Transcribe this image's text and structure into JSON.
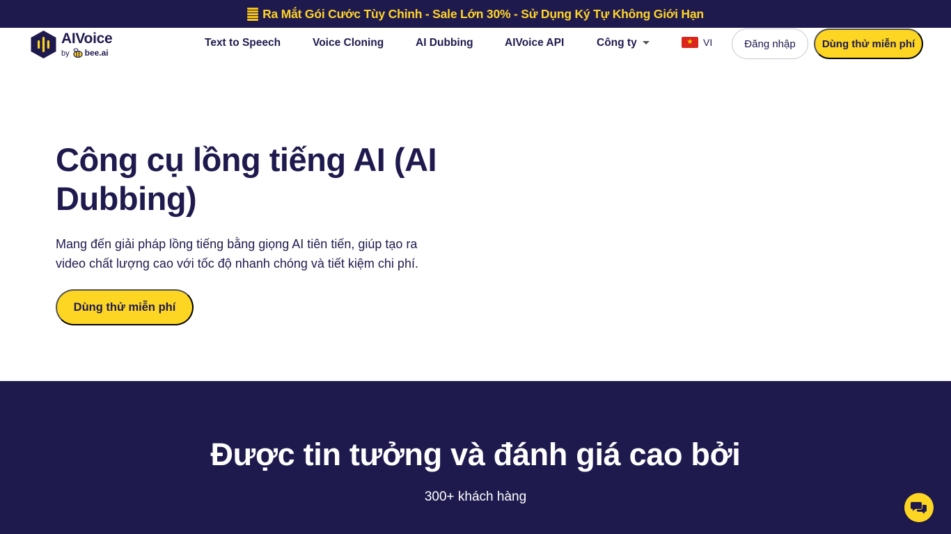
{
  "promo": {
    "icon": "coin-stack-icon",
    "text": "Ra Mắt Gói Cước Tùy Chỉnh - Sale Lớn 30% - Sử Dụng Ký Tự Không Giới Hạn"
  },
  "logo": {
    "title": "AIVoice",
    "by": "by",
    "brand": "bee.ai"
  },
  "nav": {
    "items": [
      {
        "label": "Text to Speech"
      },
      {
        "label": "Voice Cloning"
      },
      {
        "label": "AI Dubbing"
      },
      {
        "label": "AIVoice API"
      },
      {
        "label": "Công ty"
      }
    ],
    "language": "VI",
    "login_label": "Đăng nhập",
    "trial_label": "Dùng thử miễn phí"
  },
  "hero": {
    "title": "Công cụ lồng tiếng AI (AI Dubbing)",
    "description": "Mang đến giải pháp lồng tiếng bằng giọng AI tiên tiến, giúp tạo ra video chất lượng cao với tốc độ nhanh chóng và tiết kiệm chi phí.",
    "cta_label": "Dùng thử miễn phí"
  },
  "trust": {
    "title": "Được tin tưởng và đánh giá cao bởi",
    "subtitle": "300+ khách hàng"
  },
  "colors": {
    "navy": "#1f1a4e",
    "yellow": "#fdd523",
    "promo_text": "#ffd42a"
  }
}
